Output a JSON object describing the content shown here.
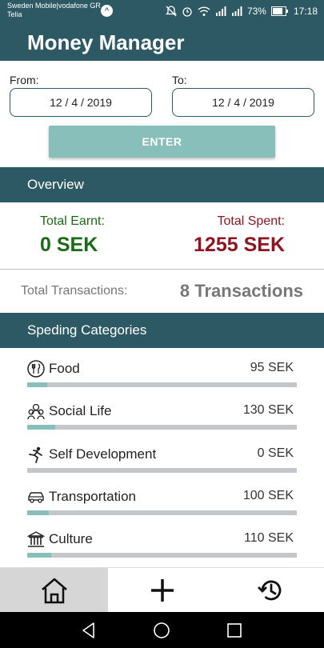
{
  "status_bar": {
    "carrier_line1": "Sweden Mobile|vodafone GR",
    "carrier_line2": "Telia",
    "battery": "73%",
    "time": "17:18"
  },
  "app": {
    "title": "Money Manager"
  },
  "date_range": {
    "from_label": "From:",
    "from_value": "12 / 4 / 2019",
    "to_label": "To:",
    "to_value": "12 / 4 / 2019",
    "enter_label": "ENTER"
  },
  "overview": {
    "header": "Overview",
    "earnt_label": "Total Earnt:",
    "earnt_value": "0 SEK",
    "spent_label": "Total Spent:",
    "spent_value": "1255 SEK",
    "transactions_label": "Total Transactions:",
    "transactions_value": "8 Transactions"
  },
  "categories": {
    "header": "Speding Categories",
    "items": [
      {
        "name": "Food",
        "amount": "95 SEK",
        "icon": "food-icon",
        "fill": 0.073
      },
      {
        "name": "Social Life",
        "amount": "130 SEK",
        "icon": "people-icon",
        "fill": 0.104
      },
      {
        "name": "Self Development",
        "amount": "0 SEK",
        "icon": "self-development-icon",
        "fill": 0.0
      },
      {
        "name": "Transportation",
        "amount": "100 SEK",
        "icon": "car-icon",
        "fill": 0.08
      },
      {
        "name": "Culture",
        "amount": "110 SEK",
        "icon": "museum-icon",
        "fill": 0.088
      }
    ]
  },
  "bottom_nav": {
    "items": [
      {
        "icon": "home-icon",
        "active": true
      },
      {
        "icon": "add-icon",
        "active": false
      },
      {
        "icon": "history-icon",
        "active": false
      }
    ]
  },
  "colors": {
    "primary": "#2d5964",
    "accent": "#89bfba",
    "earnt": "#1a6b16",
    "spent": "#8e1520"
  }
}
